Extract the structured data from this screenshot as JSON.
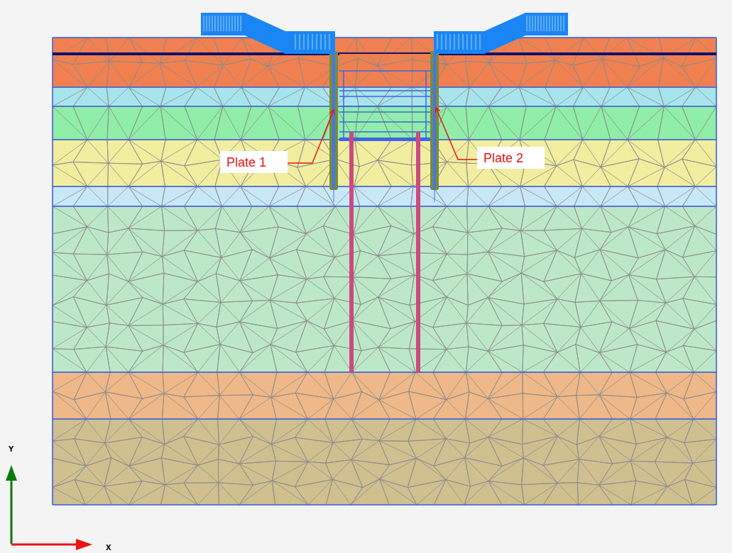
{
  "model": {
    "soil_layers": [
      {
        "color": "#f08050"
      },
      {
        "color": "#a8e4ec"
      },
      {
        "color": "#90eea8"
      },
      {
        "color": "#f2eea0"
      },
      {
        "color": "#c8e8f8"
      },
      {
        "color": "#bde8c8"
      },
      {
        "color": "#eeb888"
      },
      {
        "color": "#d0c090"
      }
    ],
    "plates": [
      {
        "label": "Plate 1"
      },
      {
        "label": "Plate 2"
      }
    ]
  },
  "axes": {
    "x_label": "X",
    "y_label": "Y"
  }
}
